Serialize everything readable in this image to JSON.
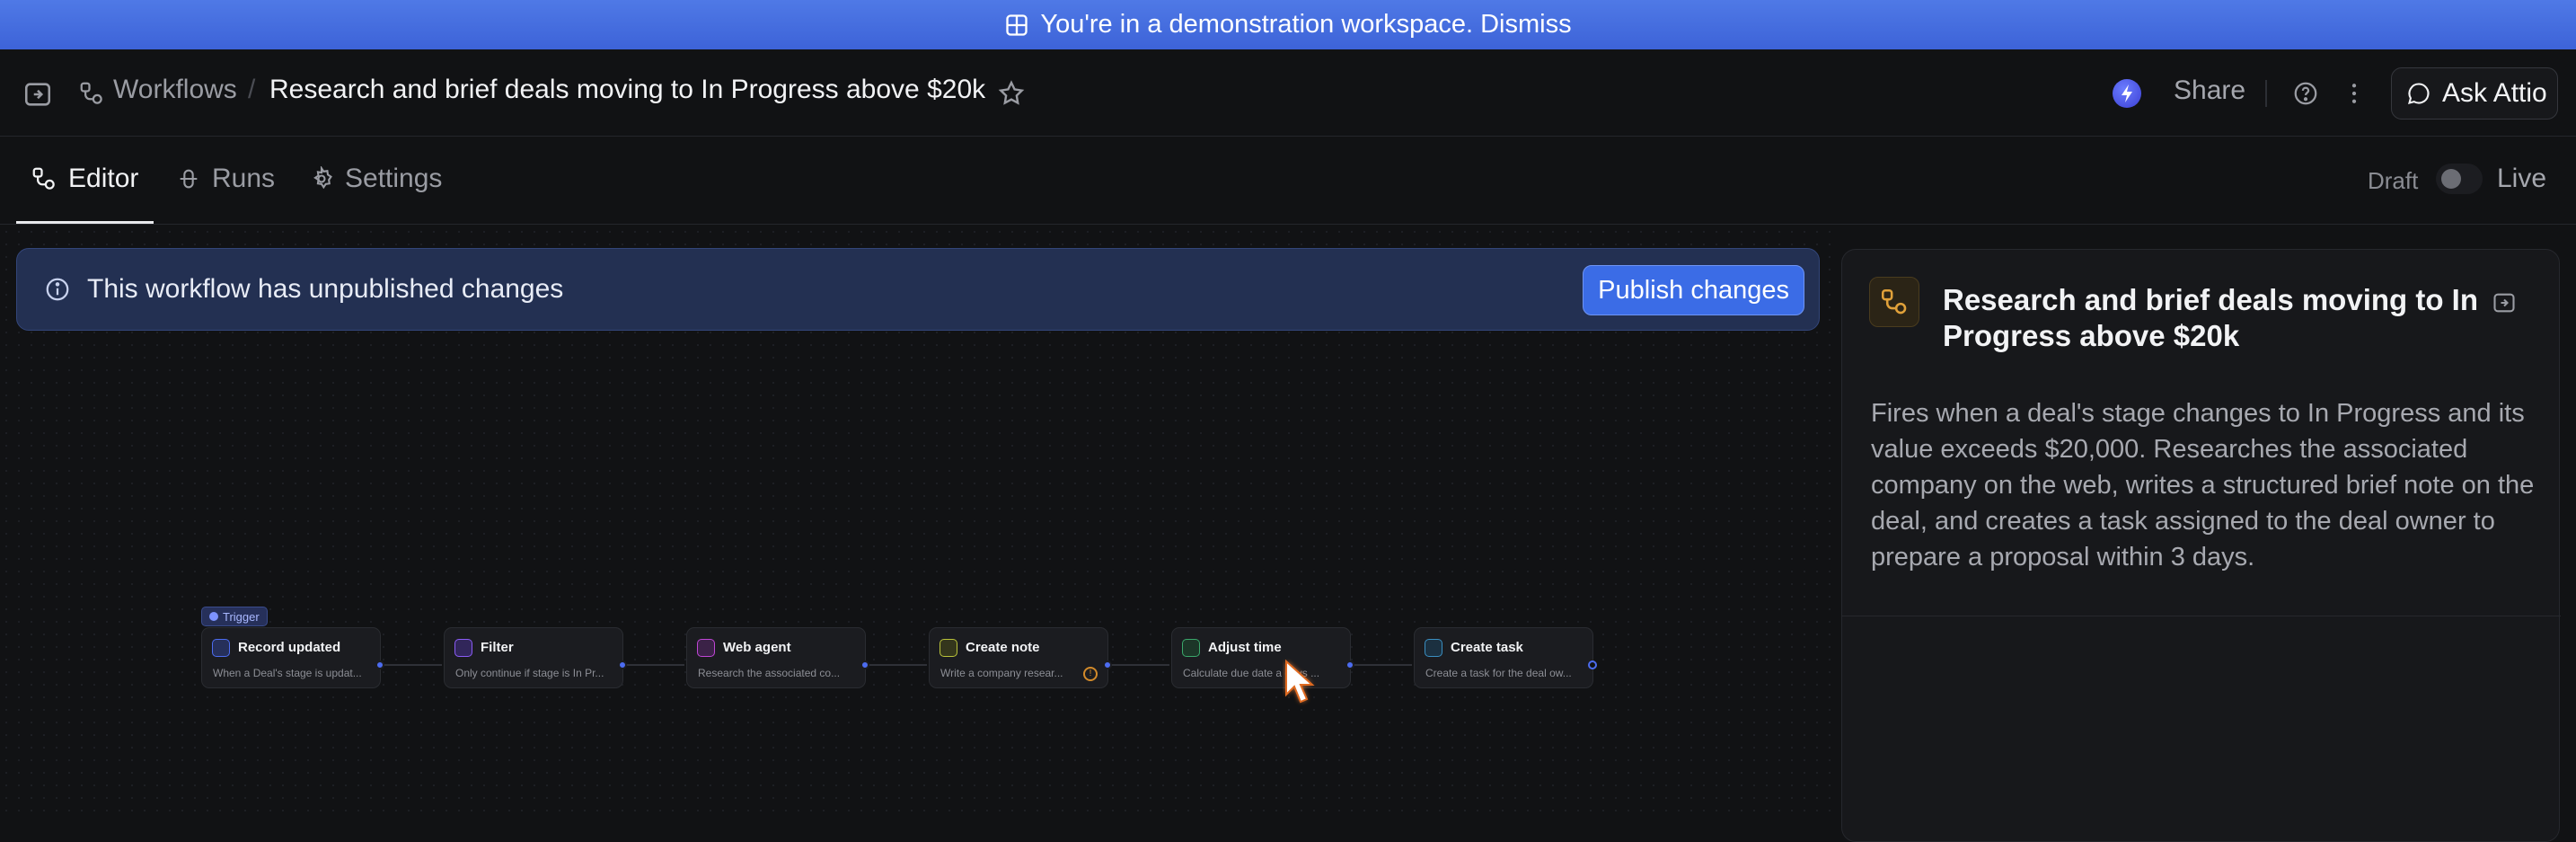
{
  "banner": {
    "text": "You're in a demonstration workspace. Dismiss"
  },
  "header": {
    "breadcrumb_root": "Workflows",
    "breadcrumb_sep": "/",
    "title": "Research and brief deals moving to In Progress above $20k",
    "share_label": "Share",
    "ask_label": "Ask Attio"
  },
  "tabs": [
    {
      "label": "Editor",
      "icon": "workflow-icon"
    },
    {
      "label": "Runs",
      "icon": "runs-icon"
    },
    {
      "label": "Settings",
      "icon": "gear-icon"
    }
  ],
  "status": {
    "draft_label": "Draft",
    "live_label": "Live"
  },
  "notice": {
    "text": "This workflow has unpublished changes",
    "button": "Publish changes"
  },
  "trigger_badge": "Trigger",
  "nodes": [
    {
      "title": "Record updated",
      "desc": "When a Deal's stage is updat...",
      "icon_color": "#4c6cf0"
    },
    {
      "title": "Filter",
      "desc": "Only continue if stage is In Pr...",
      "icon_color": "#8b5cf6"
    },
    {
      "title": "Web agent",
      "desc": "Research the associated co...",
      "icon_color": "#c046d6"
    },
    {
      "title": "Create note",
      "desc": "Write a company resear...",
      "icon_color": "#b9c23a"
    },
    {
      "title": "Adjust time",
      "desc": "Calculate due date a   days ...",
      "icon_color": "#3aa86b"
    },
    {
      "title": "Create task",
      "desc": "Create a task for the deal ow...",
      "icon_color": "#3a8fc2"
    }
  ],
  "panel": {
    "title": "Research and brief deals moving to In Progress above $20k",
    "description": "Fires when a deal's stage changes to In Progress and its value exceeds $20,000. Researches the associated company on the web, writes a structured brief note on the deal, and creates a task assigned to the deal owner to prepare a proposal within 3 days."
  },
  "colors": {
    "banner": "#4f79e6",
    "accent": "#3b6ce6",
    "panel_icon": "#e0a13a"
  }
}
